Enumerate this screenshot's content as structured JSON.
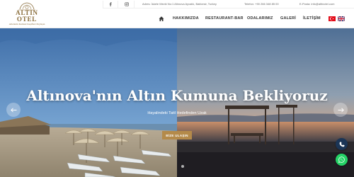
{
  "brand": {
    "name": "ALTIN OTEL",
    "tagline": "Ailenizin Kumsal Keşifleri Paylaşın"
  },
  "topbar": {
    "address": "Adres: İskele Mevki No:1 Altınova Ayvalık, Balıkesir, Turkey",
    "phone": "Telefon: +90 266 348 85 00",
    "email": "E-Posta: info@altinotel.com"
  },
  "social": [
    {
      "icon": "facebook-icon"
    },
    {
      "icon": "instagram-icon"
    }
  ],
  "nav": {
    "items": [
      {
        "label": "HAKKIMIZDA"
      },
      {
        "label": "RESTAURANT-BAR"
      },
      {
        "label": "ODALARIMIZ"
      },
      {
        "label": "GALERİ"
      },
      {
        "label": "İLETİŞİM"
      }
    ],
    "languages": [
      "turkish-flag",
      "english-flag"
    ]
  },
  "hero": {
    "title": "Altınova'nın Altın Kumuna Bekliyoruz",
    "subtitle": "Hayalindeki Tatil Hedefinden Uzak",
    "cta": "BİZE ULAŞIN"
  },
  "colors": {
    "accent": "#b48a4a",
    "phone_fab": "#1b3556",
    "whatsapp_fab": "#25d366"
  }
}
